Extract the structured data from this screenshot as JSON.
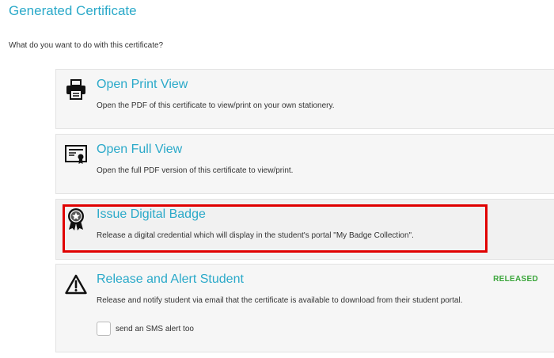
{
  "header": {
    "title": "Generated Certificate",
    "prompt": "What do you want to do with this certificate?"
  },
  "options": [
    {
      "icon": "printer-icon",
      "title": "Open Print View",
      "description": "Open the PDF of this certificate to view/print on your own stationery."
    },
    {
      "icon": "certificate-icon",
      "title": "Open Full View",
      "description": "Open the full PDF version of this certificate to view/print."
    },
    {
      "icon": "badge-icon",
      "title": "Issue Digital Badge",
      "description": "Release a digital credential which will display in the student's portal \"My Badge Collection\"."
    },
    {
      "icon": "warning-icon",
      "title": "Release and Alert Student",
      "description": "Release and notify student via email that the certificate is available to download from their student portal.",
      "status": "RELEASED",
      "sms_label": "send an SMS alert too"
    }
  ],
  "colors": {
    "accent": "#2aa9c9",
    "released": "#3aa53a",
    "highlight": "#e00000"
  }
}
